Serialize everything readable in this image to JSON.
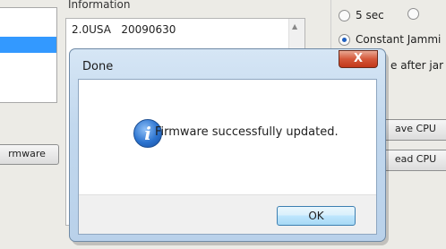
{
  "left_panel": {
    "firmware_button_label": "rmware"
  },
  "information": {
    "label": "Information",
    "line": "2.0USA   20090630"
  },
  "right_panel": {
    "options": [
      {
        "label": "5 sec",
        "selected": false
      },
      {
        "label": "Constant Jammi",
        "selected": true
      },
      {
        "label": "e after jar"
      }
    ],
    "save_cpu_label": "ave CPU",
    "read_cpu_label": "ead CPU"
  },
  "dialog": {
    "title": "Done",
    "close_glyph": "X",
    "icon": "info-icon",
    "icon_glyph": "i",
    "message": "Firmware successfully updated.",
    "ok_label": "OK"
  }
}
